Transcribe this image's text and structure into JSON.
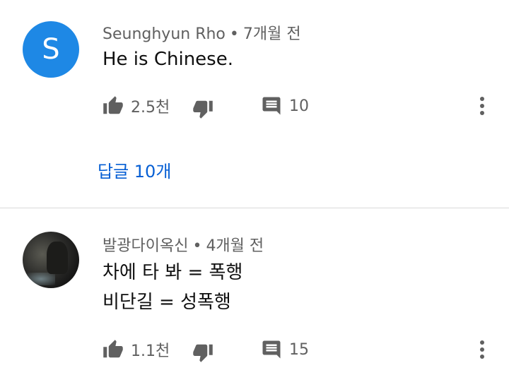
{
  "comments": [
    {
      "avatar_letter": "S",
      "avatar_color": "#1e88e5",
      "author": "Seunghyun Rho",
      "separator": "•",
      "time": "7개월 전",
      "lines": [
        "He is Chinese."
      ],
      "likes": "2.5천",
      "reply_count": "10",
      "replies_link": "답글 10개"
    },
    {
      "avatar_letter": "",
      "author": "발광다이옥신",
      "separator": "•",
      "time": "4개월 전",
      "lines": [
        "차에 타 봐 = 폭행",
        "비단길 = 성폭행"
      ],
      "likes": "1.1천",
      "reply_count": "15"
    }
  ],
  "colors": {
    "link": "#065fd4",
    "meta_text": "#606060",
    "icon": "#606060",
    "divider": "#d9d9d9"
  },
  "icons": [
    "thumb-up-icon",
    "thumb-down-icon",
    "comment-icon",
    "more-vert-icon"
  ]
}
